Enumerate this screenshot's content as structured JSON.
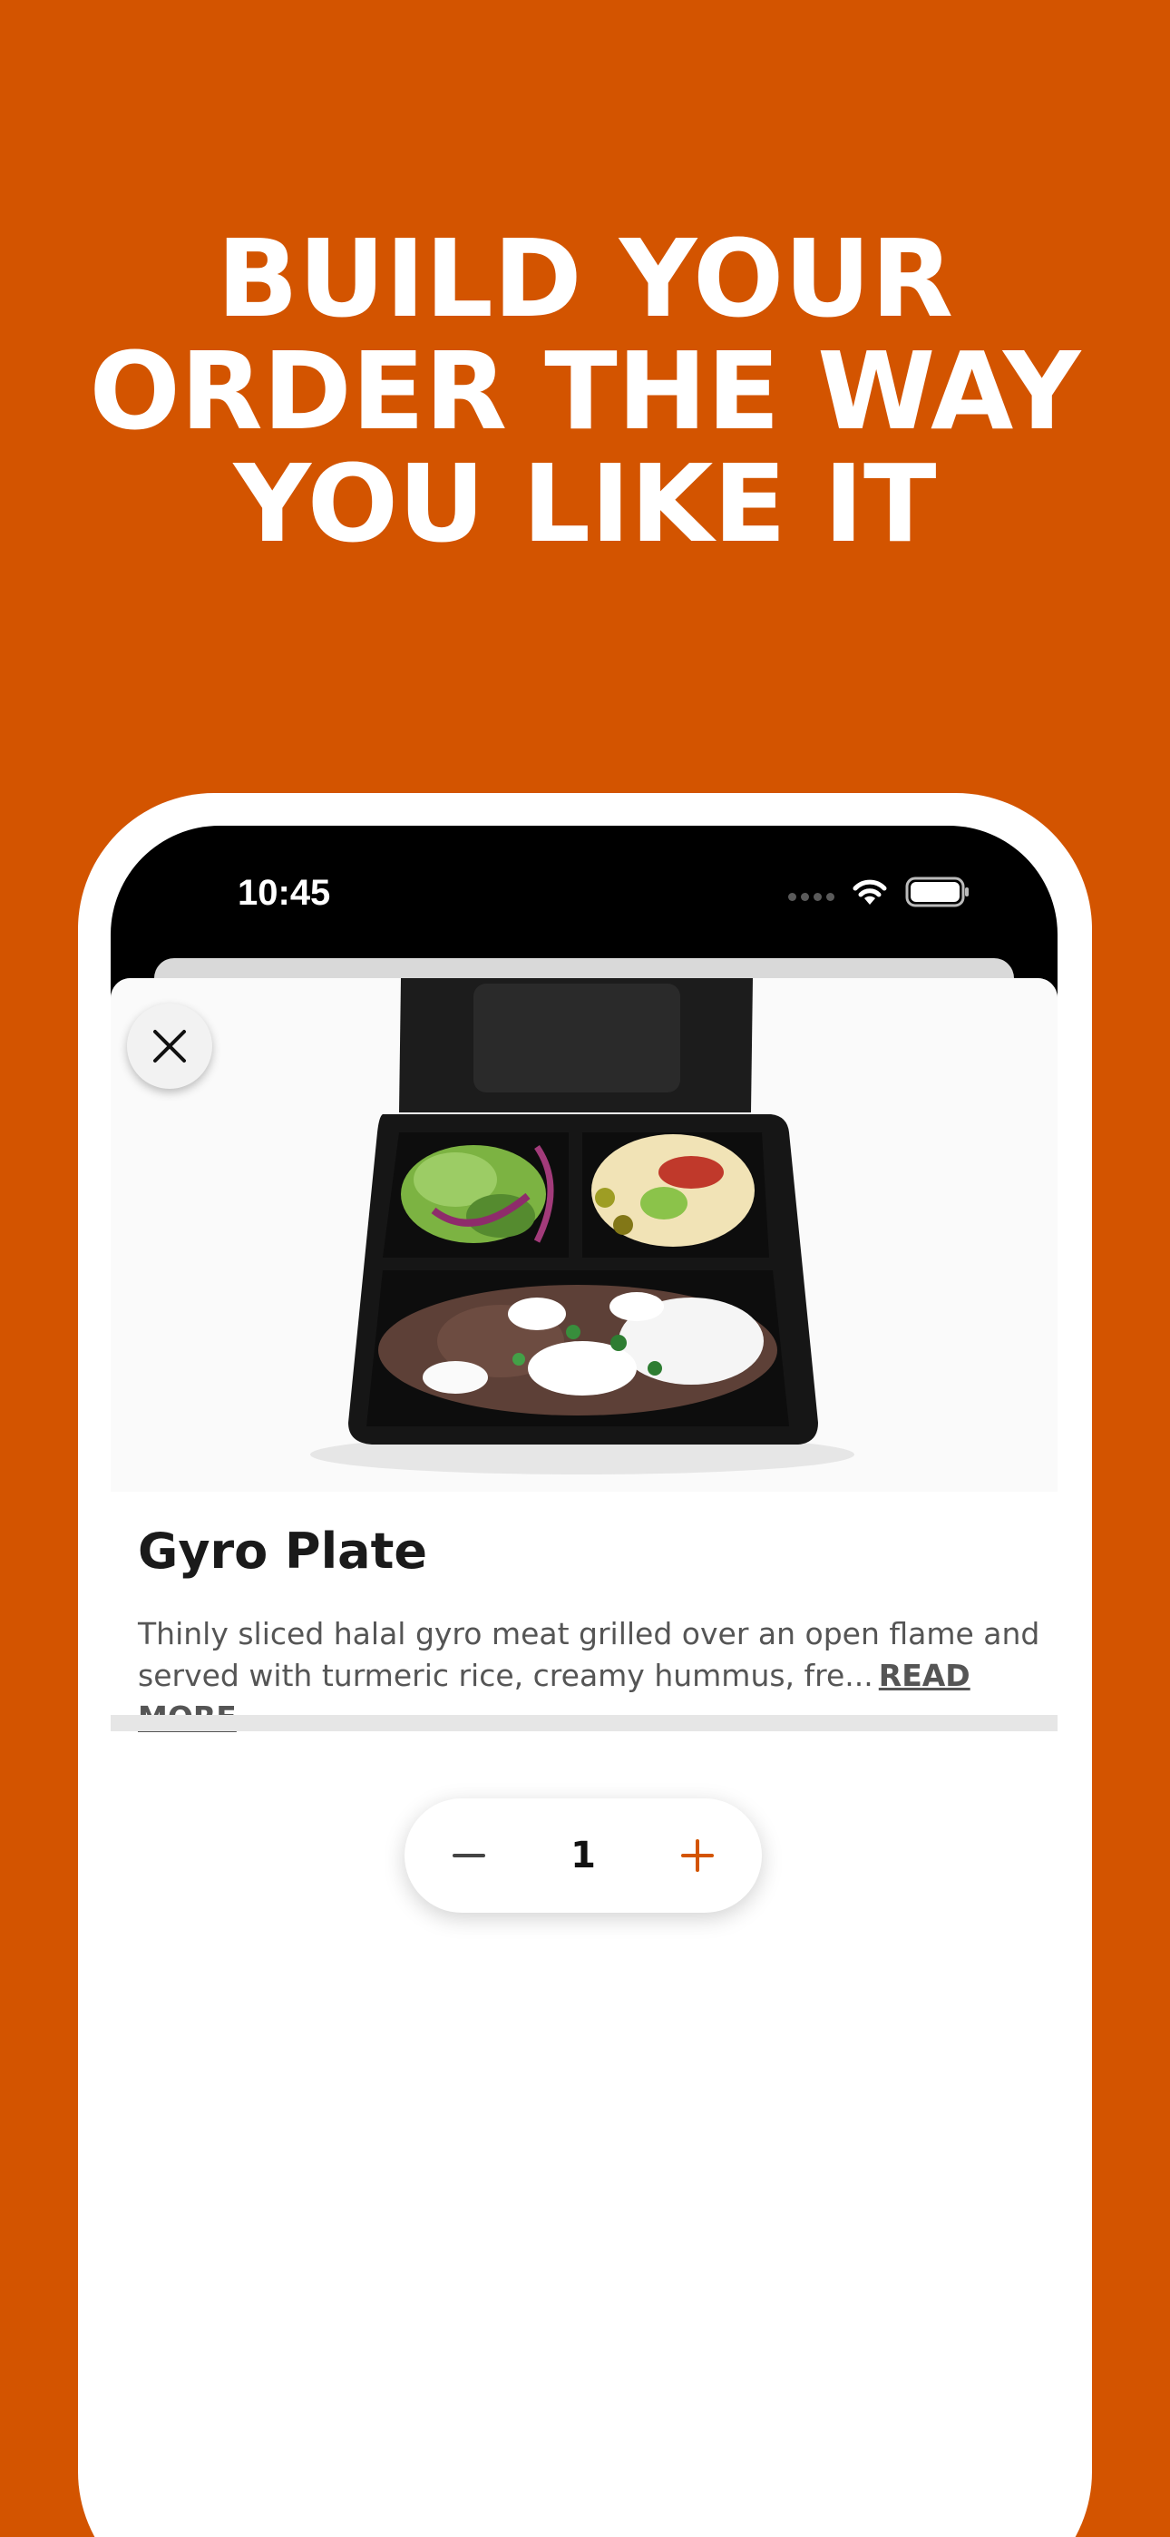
{
  "headline": {
    "line1": "BUILD YOUR",
    "line2": "ORDER THE WAY",
    "line3": "YOU LIKE IT"
  },
  "status_bar": {
    "time": "10:45"
  },
  "item": {
    "name": "Gyro Plate",
    "description": "Thinly sliced halal gyro meat grilled over an open flame and served with turmeric rice, creamy hummus, fre...",
    "read_more_label": "READ MORE"
  },
  "quantity": {
    "value": "1"
  },
  "colors": {
    "brand": "#D35400",
    "accent_plus": "#D35400"
  },
  "icons": {
    "close": "close-icon",
    "minus": "minus-icon",
    "plus": "plus-icon",
    "wifi": "wifi-icon",
    "battery": "battery-icon"
  }
}
